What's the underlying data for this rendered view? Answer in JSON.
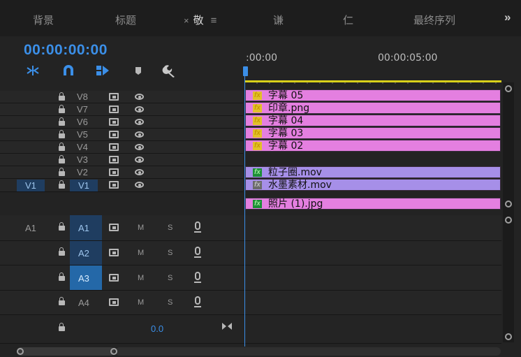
{
  "tabs": [
    {
      "label": "背景"
    },
    {
      "label": "标题"
    },
    {
      "label": "敬",
      "close": "×",
      "menu": "≡"
    },
    {
      "label": "谦"
    },
    {
      "label": "仁"
    },
    {
      "label": "最终序列"
    }
  ],
  "more_tabs": "»",
  "timecode": "00:00:00:00",
  "toolbar_icons": [
    "nest-sequence-icon",
    "snap-magnet-icon",
    "linked-selection-icon",
    "add-marker-icon",
    "wrench-settings-icon"
  ],
  "ruler": {
    "start_label": ":00:00",
    "mid_label": "00:00:05:00"
  },
  "video_tracks": [
    {
      "name": "V8"
    },
    {
      "name": "V7"
    },
    {
      "name": "V6"
    },
    {
      "name": "V5"
    },
    {
      "name": "V4"
    },
    {
      "name": "V3"
    },
    {
      "name": "V2"
    },
    {
      "name": "V1",
      "source": "V1"
    }
  ],
  "audio_tracks": [
    {
      "name": "A1",
      "source": "A1",
      "m": "M",
      "s": "S"
    },
    {
      "name": "A2",
      "m": "M",
      "s": "S"
    },
    {
      "name": "A3",
      "m": "M",
      "s": "S"
    },
    {
      "name": "A4",
      "m": "M",
      "s": "S"
    }
  ],
  "master": {
    "volume": "0.0"
  },
  "clips": [
    {
      "label": "字幕 05",
      "fx": "fx"
    },
    {
      "label": "印章.png",
      "fx": "fx"
    },
    {
      "label": "字幕 04",
      "fx": "fx"
    },
    {
      "label": "字幕 03",
      "fx": "fx"
    },
    {
      "label": "字幕 02",
      "fx": "fx"
    },
    {
      "label": "粒子圈.mov",
      "fx": "fx"
    },
    {
      "label": "水墨素材.mov",
      "fx": "fx"
    },
    {
      "label": "照片 (1).jpg",
      "fx": "fx"
    }
  ],
  "colors": {
    "accent": "#3b8fe8",
    "clip_pink": "#e47fe0",
    "clip_purple": "#a68fe8",
    "workarea": "#d9d11a"
  }
}
